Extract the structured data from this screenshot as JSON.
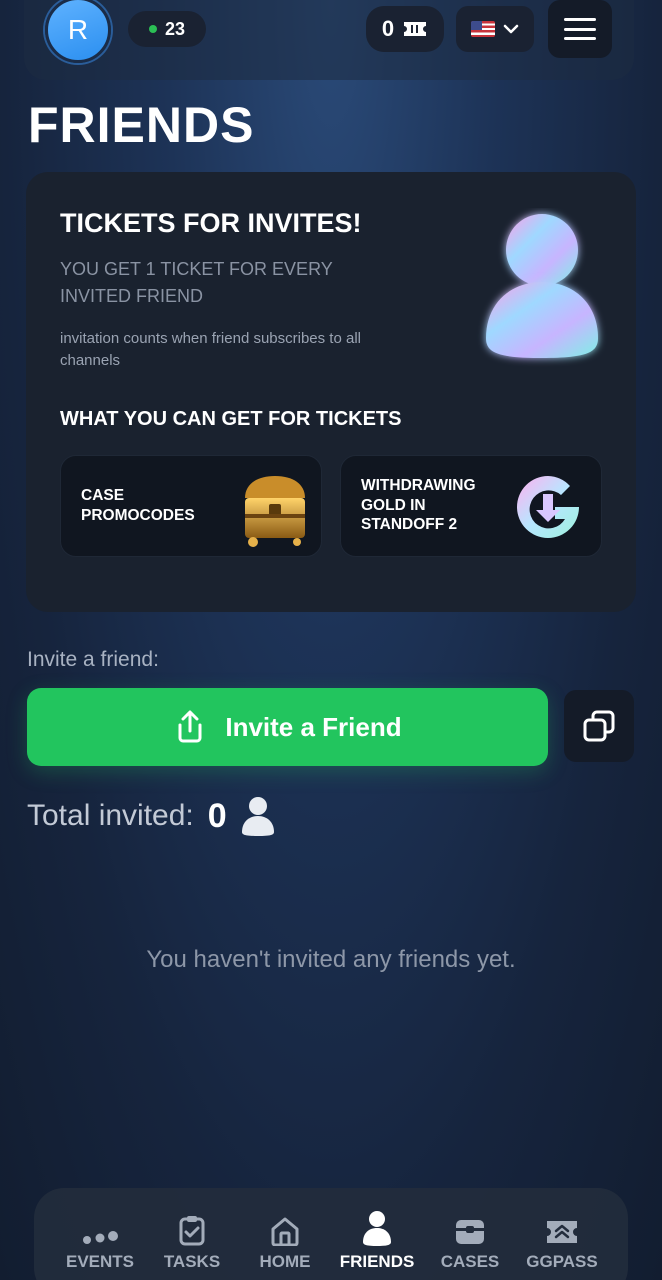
{
  "header": {
    "avatar_letter": "R",
    "online_count": "23",
    "tickets_count": "0",
    "language": "US flag"
  },
  "page_title": "FRIENDS",
  "promo": {
    "title": "TICKETS FOR INVITES!",
    "subtitle": "YOU GET 1 TICKET FOR EVERY INVITED FRIEND",
    "note": "invitation counts when friend subscribes to all channels",
    "rewards_heading": "WHAT YOU CAN GET FOR TICKETS",
    "rewards": [
      {
        "label": "CASE PROMOCODES"
      },
      {
        "label": "WITHDRAWING GOLD IN STANDOFF 2"
      }
    ]
  },
  "invite": {
    "label": "Invite a friend:",
    "button_label": "Invite a Friend"
  },
  "total": {
    "label": "Total invited:",
    "count": "0"
  },
  "empty_message": "You haven't invited any friends yet.",
  "nav": {
    "items": [
      {
        "label": "EVENTS"
      },
      {
        "label": "TASKS"
      },
      {
        "label": "HOME"
      },
      {
        "label": "FRIENDS"
      },
      {
        "label": "CASES"
      },
      {
        "label": "GGPASS"
      }
    ],
    "active": "FRIENDS"
  },
  "colors": {
    "accent_green": "#22c55e",
    "online_dot": "#2bbf55",
    "avatar_blue": "#2b8ff0"
  }
}
